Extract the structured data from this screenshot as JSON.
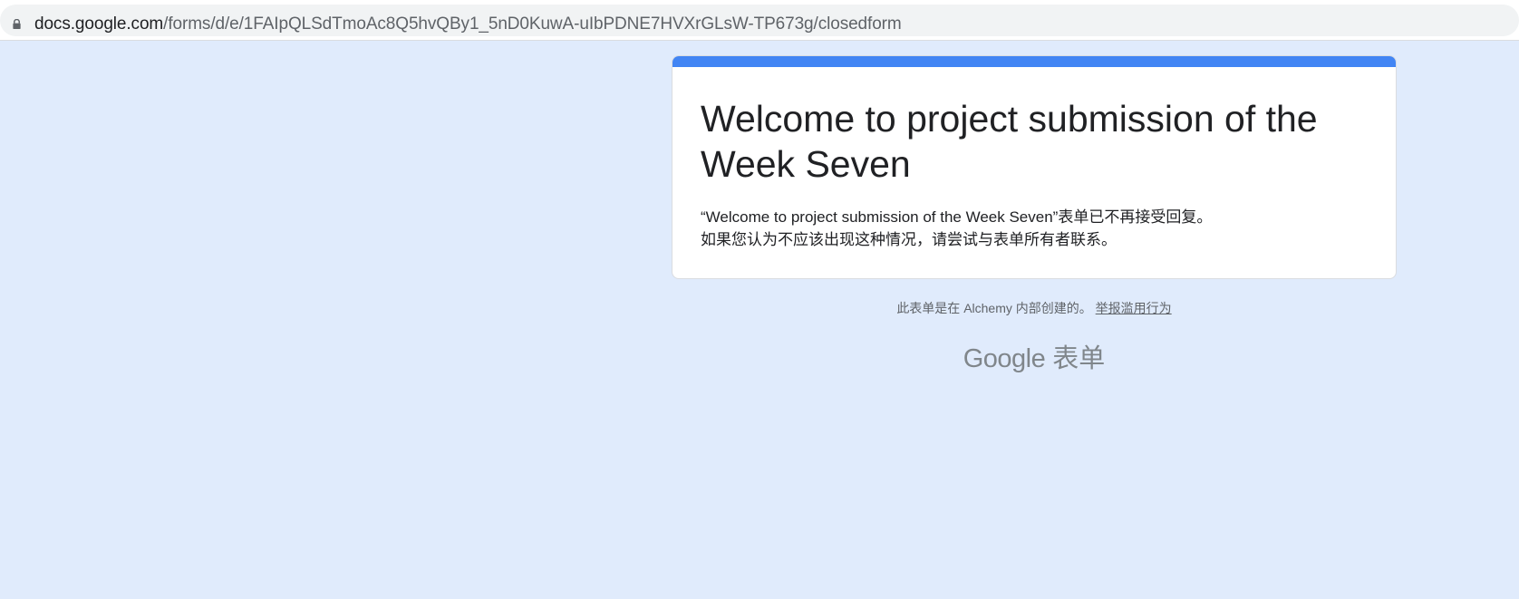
{
  "browser": {
    "url_host": "docs.google.com",
    "url_path": "/forms/d/e/1FAIpQLSdTmoAc8Q5hvQBy1_5nD0KuwA-uIbPDNE7HVXrGLsW-TP673g/closedform"
  },
  "form": {
    "title": "Welcome to project submission of the Week Seven",
    "closed_line1": "“Welcome to project submission of the Week Seven”表单已不再接受回复。",
    "closed_line2": "如果您认为不应该出现这种情况，请尝试与表单所有者联系。"
  },
  "footer": {
    "created_text": "此表单是在 Alchemy 内部创建的。",
    "report_link": "举报滥用行为"
  },
  "brand": {
    "google": "Google",
    "product": "表单"
  },
  "colors": {
    "accent": "#4285f4",
    "background": "#e0ebfc"
  },
  "icons": {
    "lock": "lock-icon"
  }
}
